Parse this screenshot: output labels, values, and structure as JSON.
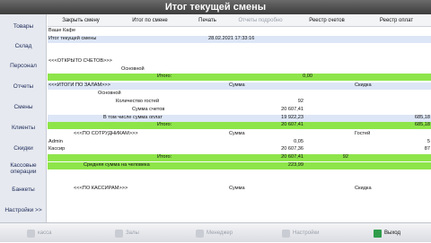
{
  "window": {
    "title": "Итог текущей смены"
  },
  "sidebar": {
    "items": [
      {
        "label": "Товары"
      },
      {
        "label": "Склад"
      },
      {
        "label": "Персонал"
      },
      {
        "label": "Отчеты"
      },
      {
        "label": "Смены"
      },
      {
        "label": "Клиенты"
      },
      {
        "label": "Скидки"
      },
      {
        "label": "Кассовые операции"
      },
      {
        "label": "Банкеты"
      },
      {
        "label": "Настройки >>"
      }
    ]
  },
  "toolbar": {
    "close_shift": "Закрыть смену",
    "shift_total": "Итог по смене",
    "print": "Печать",
    "details": "Отчеты подробно",
    "check_register": "Реестр счетов",
    "payment_register": "Реестр оплат"
  },
  "report": {
    "cafe": "Ваше Кафе",
    "current_shift_total": "Итог текущей смены",
    "datetime": "28.02.2021 17:33:16",
    "open_checks_header": "<<<ОТКРЫТО СЧЕТОВ>>>",
    "main_label": "Основной",
    "total_label": "Итого:",
    "open_total": "0,00",
    "halls_header": "<<<ИТОГИ ПО ЗАЛАМ>>>",
    "sum_col": "Сумма",
    "discount_col": "Скидка",
    "guests_label": "Количество гостей",
    "guests_value": "92",
    "checks_sum_label": "Сумма счетов",
    "checks_sum_value": "20 607,41",
    "payments_label": "В том числе сумма оплат",
    "payments_value": "19 922,23",
    "payments_discount": "685,18",
    "halls_total": "20 607,41",
    "halls_discount": "685,18",
    "staff_header": "<<<ПО СОТРУДНИКАМ>>>",
    "guests_col": "Гостей",
    "staff": [
      {
        "name": "Admin",
        "sum": "0,05",
        "guests": "5"
      },
      {
        "name": "Кассир",
        "sum": "20 607,36",
        "guests": "87"
      }
    ],
    "staff_total": "20 607,41",
    "staff_guests_total": "92",
    "avg_label": "Средняя сумма на человека",
    "avg_value": "223,99",
    "cashiers_header": "<<<ПО КАССИРАМ>>>"
  },
  "bottombar": {
    "kassa": "касса",
    "zaly": "Залы",
    "menedzher": "Менеджер",
    "nastroyki": "Настройки",
    "vyhod": "Выход"
  }
}
